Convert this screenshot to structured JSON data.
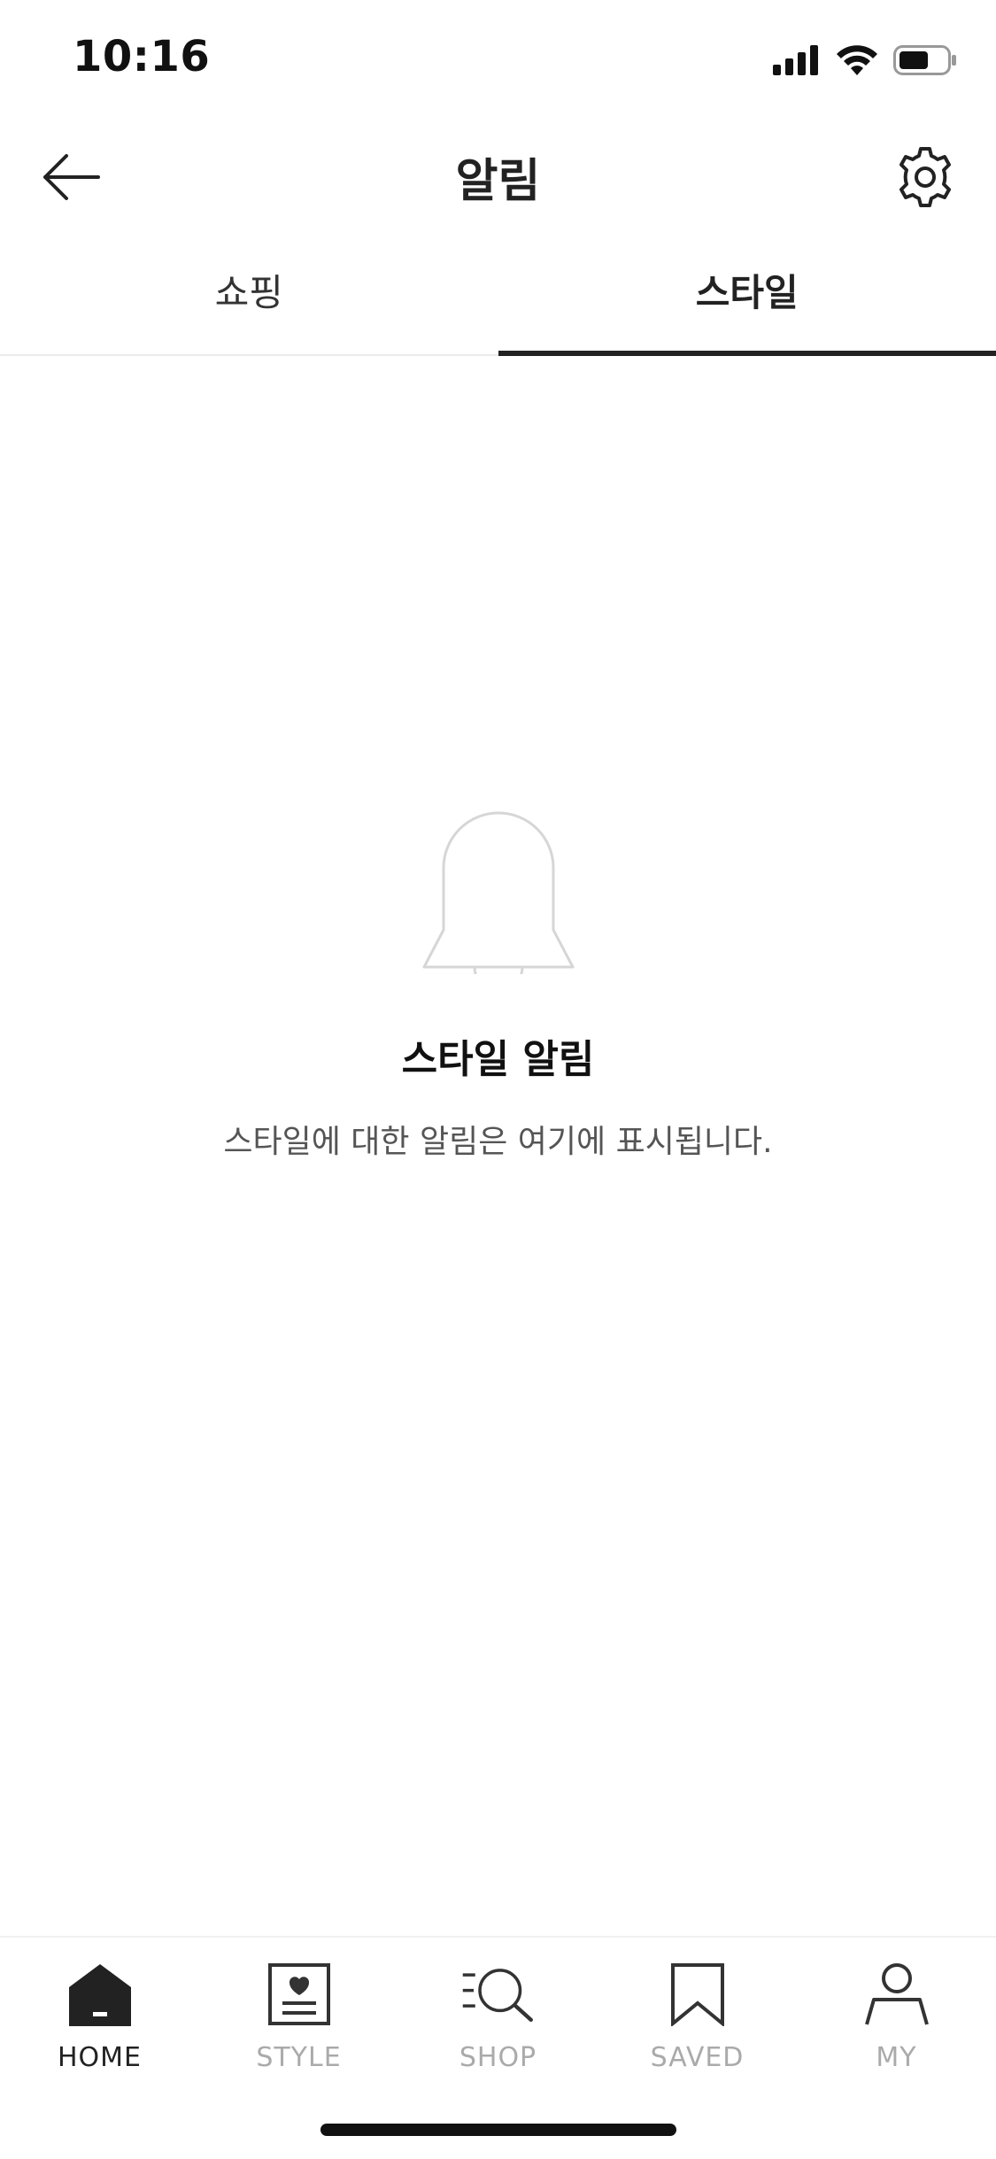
{
  "status_bar": {
    "time": "10:16",
    "icons": [
      "signal-icon",
      "wifi-icon",
      "battery-icon"
    ]
  },
  "header": {
    "title": "알림",
    "back_icon": "arrow-left-icon",
    "settings_icon": "gear-icon"
  },
  "tabs": [
    {
      "label": "쇼핑",
      "active": false
    },
    {
      "label": "스타일",
      "active": true
    }
  ],
  "empty_state": {
    "icon": "bell-icon",
    "title": "스타일 알림",
    "description": "스타일에 대한 알림은 여기에 표시됩니다."
  },
  "bottom_nav": {
    "items": [
      {
        "label": "HOME",
        "icon": "home-icon",
        "active": true
      },
      {
        "label": "STYLE",
        "icon": "style-icon",
        "active": false
      },
      {
        "label": "SHOP",
        "icon": "shop-search-icon",
        "active": false
      },
      {
        "label": "SAVED",
        "icon": "bookmark-icon",
        "active": false
      },
      {
        "label": "MY",
        "icon": "person-icon",
        "active": false
      }
    ]
  },
  "colors": {
    "text_primary": "#222222",
    "text_secondary": "#555555",
    "inactive": "#aaaaaa",
    "divider": "#ebebeb"
  }
}
